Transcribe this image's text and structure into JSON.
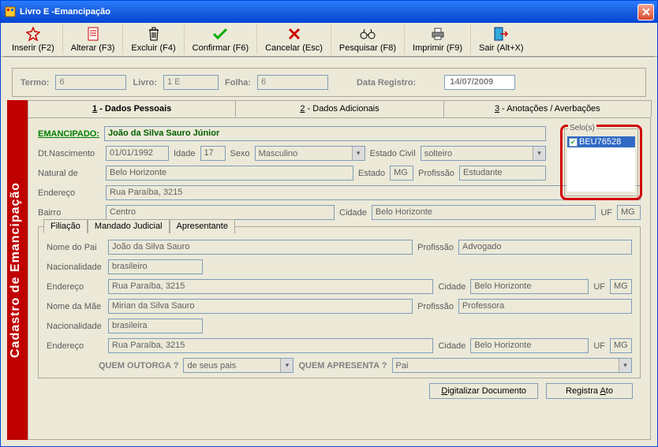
{
  "window": {
    "title": "Livro E -Emancipação"
  },
  "toolbar": {
    "insert": "Inserir (F2)",
    "edit": "Alterar (F3)",
    "delete": "Excluir (F4)",
    "confirm": "Confirmar (F6)",
    "cancel": "Cancelar (Esc)",
    "search": "Pesquisar (F8)",
    "print": "Imprimir (F9)",
    "exit": "Sair (Alt+X)"
  },
  "topinfo": {
    "termo_lbl": "Termo:",
    "termo": "6",
    "livro_lbl": "Livro:",
    "livro": "1 E",
    "folha_lbl": "Folha:",
    "folha": "6",
    "data_lbl": "Data Registro:",
    "data": "14/07/2009"
  },
  "side_label": "Cadastro de Emancipação",
  "tabs": {
    "t1": "1 - Dados Pessoais",
    "t2": "2 - Dados Adicionais",
    "t3": "3 - Anotações / Averbações"
  },
  "emancipado": {
    "label": "EMANCIPADO:",
    "nome": "João da Silva Sauro Júnior",
    "dtnasc_lbl": "Dt.Nascimento",
    "dtnasc": "01/01/1992",
    "idade_lbl": "Idade",
    "idade": "17",
    "sexo_lbl": "Sexo",
    "sexo": "Masculino",
    "estcivil_lbl": "Estado Civil",
    "estcivil": "solteiro",
    "natural_lbl": "Natural de",
    "natural": "Belo Horizonte",
    "estado_lbl": "Estado",
    "estado": "MG",
    "profissao_lbl": "Profissão",
    "profissao": "Estudante",
    "endereco_lbl": "Endereço",
    "endereco": "Rua Paraíba, 3215",
    "bairro_lbl": "Bairro",
    "bairro": "Centro",
    "cidade_lbl": "Cidade",
    "cidade": "Belo Horizonte",
    "uf_lbl": "UF",
    "uf": "MG"
  },
  "selos": {
    "legend": "Selo(s)",
    "item0": "BEU76528"
  },
  "subtabs": {
    "filiacao": "Filiação",
    "mandado": "Mandado Judicial",
    "apresentante": "Apresentante"
  },
  "pai": {
    "nome_lbl": "Nome do Pai",
    "nome": "João da Silva Sauro",
    "prof_lbl": "Profissão",
    "prof": "Advogado",
    "nac_lbl": "Nacionalidade",
    "nac": "brasileiro",
    "end_lbl": "Endereço",
    "end": "Rua Paraíba, 3215",
    "cid_lbl": "Cidade",
    "cid": "Belo Horizonte",
    "uf_lbl": "UF",
    "uf": "MG"
  },
  "mae": {
    "nome_lbl": "Nome da Mãe",
    "nome": "Mirian da Silva Sauro",
    "prof_lbl": "Profissão",
    "prof": "Professora",
    "nac_lbl": "Nacionalidade",
    "nac": "brasileira",
    "end_lbl": "Endereço",
    "end": "Rua Paraíba, 3215",
    "cid_lbl": "Cidade",
    "cid": "Belo Horizonte",
    "uf_lbl": "UF",
    "uf": "MG"
  },
  "outorga": {
    "quem_lbl": "QUEM OUTORGA ?",
    "quem_val": "de seus pais",
    "apresenta_lbl": "QUEM APRESENTA ?",
    "apresenta_val": "Pai"
  },
  "buttons": {
    "digitalizar": "Digitalizar Documento",
    "registra_pre": "Registra ",
    "registra_u": "A",
    "registra_post": "to"
  }
}
